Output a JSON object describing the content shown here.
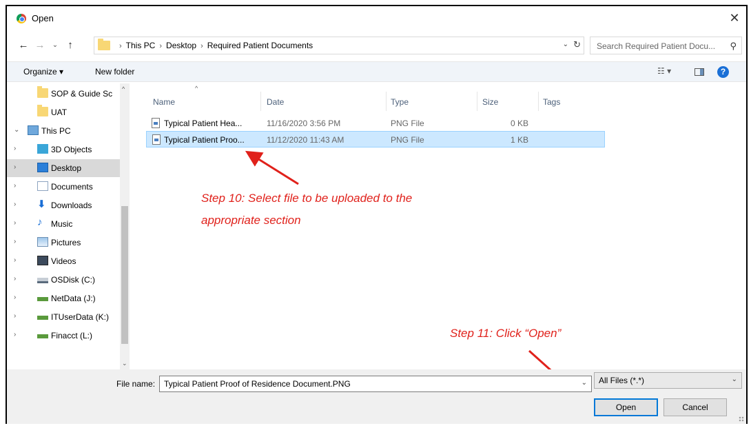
{
  "window": {
    "title": "Open",
    "close_glyph": "✕"
  },
  "address_bar": {
    "crumbs": [
      "This PC",
      "Desktop",
      "Required Patient Documents"
    ]
  },
  "search": {
    "placeholder": "Search Required Patient Docu..."
  },
  "toolbar": {
    "organize_label": "Organize ▾",
    "new_folder_label": "New folder",
    "view_glyph": "☷ ▾",
    "help_glyph": "?"
  },
  "nav_pane": {
    "items": [
      {
        "label": "SOP & Guide Sc",
        "icon": "folder-icon",
        "chevron": ""
      },
      {
        "label": "UAT",
        "icon": "folder-icon",
        "chevron": ""
      },
      {
        "label": "This PC",
        "icon": "computer-icon",
        "chevron": "⌄"
      },
      {
        "label": "3D Objects",
        "icon": "3d-objects-icon",
        "chevron": "›"
      },
      {
        "label": "Desktop",
        "icon": "desktop-icon",
        "chevron": "›"
      },
      {
        "label": "Documents",
        "icon": "documents-icon",
        "chevron": "›"
      },
      {
        "label": "Downloads",
        "icon": "downloads-icon",
        "chevron": "›"
      },
      {
        "label": "Music",
        "icon": "music-icon",
        "chevron": "›"
      },
      {
        "label": "Pictures",
        "icon": "pictures-icon",
        "chevron": "›"
      },
      {
        "label": "Videos",
        "icon": "videos-icon",
        "chevron": "›"
      },
      {
        "label": "OSDisk (C:)",
        "icon": "disk-icon",
        "chevron": "›"
      },
      {
        "label": "NetData (J:)",
        "icon": "network-drive-icon",
        "chevron": "›"
      },
      {
        "label": "ITUserData (K:)",
        "icon": "network-drive-icon",
        "chevron": "›"
      },
      {
        "label": "Finacct (L:)",
        "icon": "network-drive-icon",
        "chevron": "›"
      }
    ]
  },
  "file_list": {
    "columns": [
      "Name",
      "Date",
      "Type",
      "Size",
      "Tags"
    ],
    "rows": [
      {
        "name": "Typical Patient Hea...",
        "date": "11/16/2020 3:56 PM",
        "type": "PNG File",
        "size": "0 KB"
      },
      {
        "name": "Typical Patient Proo...",
        "date": "11/12/2020 11:43 AM",
        "type": "PNG File",
        "size": "1 KB"
      }
    ]
  },
  "annotations": {
    "step10_line1": "Step 10: Select file to be uploaded to the",
    "step10_line2": "appropriate section",
    "step11": "Step 11: Click “Open”"
  },
  "bottom": {
    "file_name_label": "File name:",
    "file_name_value": "Typical Patient Proof of Residence Document.PNG",
    "filter_value": "All Files (*.*)",
    "open_label": "Open",
    "cancel_label": "Cancel"
  },
  "colors": {
    "annotation": "#e0211b",
    "selection": "#cce8ff",
    "accent": "#0078d7"
  }
}
